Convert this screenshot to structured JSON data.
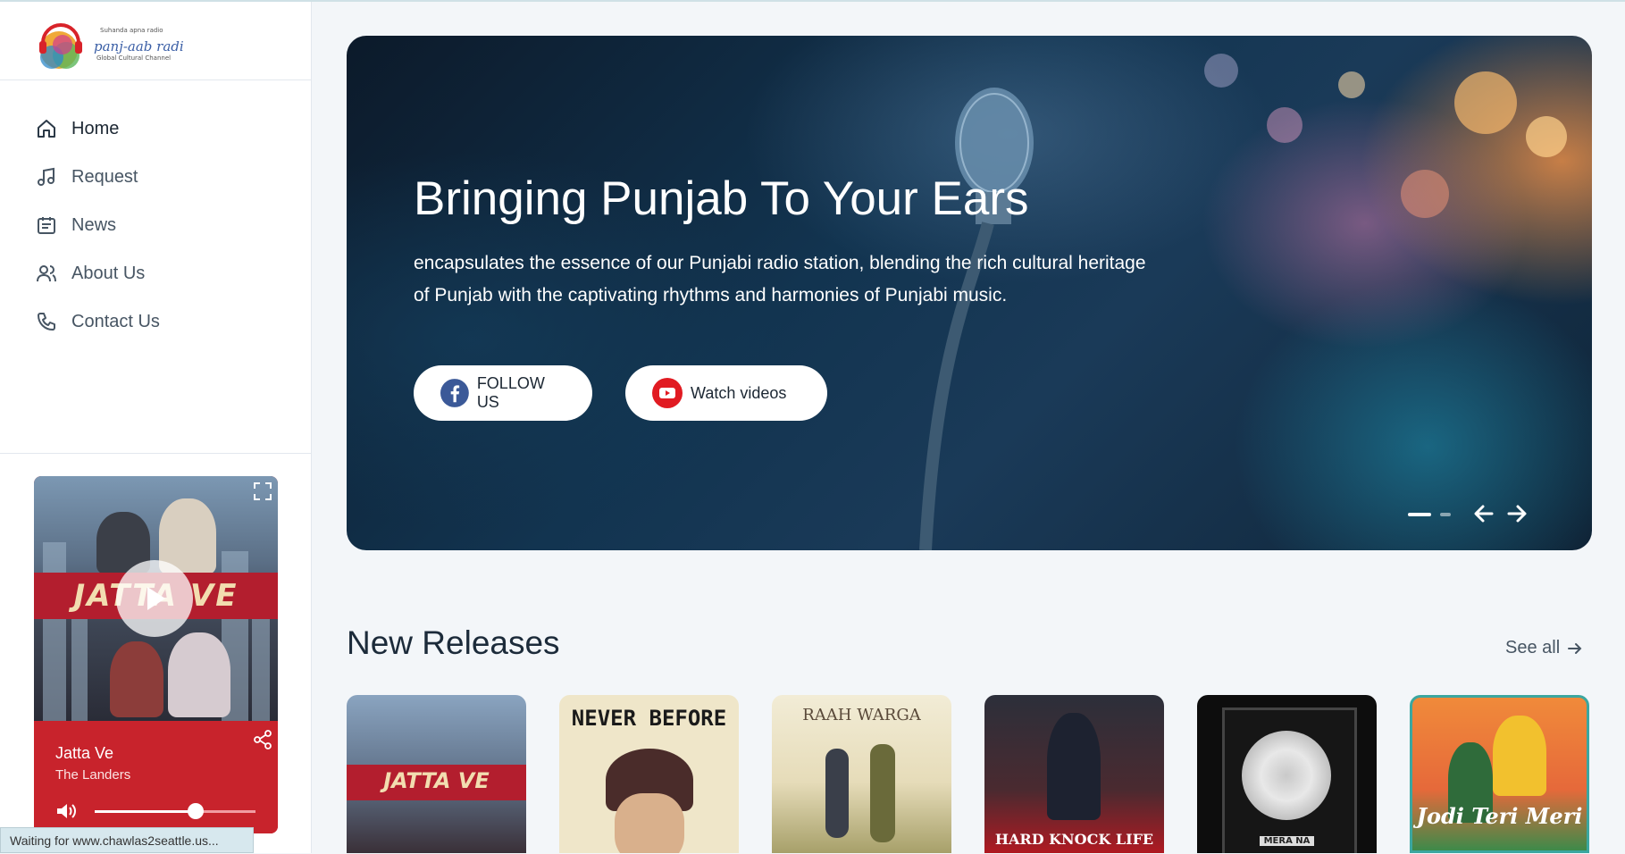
{
  "logo": {
    "tagline": "Suhanda apna radio",
    "name": "panj-aab radio",
    "subtitle": "Global Cultural Channel"
  },
  "nav": [
    {
      "label": "Home",
      "icon": "home-icon",
      "active": true
    },
    {
      "label": "Request",
      "icon": "music-note-icon"
    },
    {
      "label": "News",
      "icon": "calendar-icon"
    },
    {
      "label": "About Us",
      "icon": "users-icon"
    },
    {
      "label": "Contact Us",
      "icon": "phone-icon"
    }
  ],
  "player": {
    "track_title": "Jatta Ve",
    "track_artist": "The Landers",
    "art_text": "JATTA VE",
    "volume": 0.63,
    "accent": "#c8232c"
  },
  "hero": {
    "title": "Bringing Punjab To Your Ears",
    "text": "encapsulates the essence of our Punjabi radio station, blending the rich cultural heritage of Punjab with the captivating rhythms and harmonies of Punjabi music.",
    "follow_label": "FOLLOW US",
    "watch_label": "Watch videos",
    "slide_current": 1,
    "slide_count": 2
  },
  "releases": {
    "title": "New Releases",
    "see_all": "See all",
    "items": [
      {
        "art_text": "JATTA VE",
        "bg": "#6e87a3"
      },
      {
        "art_text": "NEVER BEFORE",
        "bg": "#efe6c9"
      },
      {
        "art_text": "RAAH WARGA",
        "bg": "#e9e4cf"
      },
      {
        "art_text": "HARD KNOCK LIFE",
        "bg": "#3a2a2e"
      },
      {
        "art_text": "MERA NA",
        "bg": "#0d0d0d"
      },
      {
        "art_text": "Jodi Teri Meri",
        "bg": "#e6693a"
      }
    ]
  },
  "status_bar": "Waiting for www.chawlas2seattle.us..."
}
